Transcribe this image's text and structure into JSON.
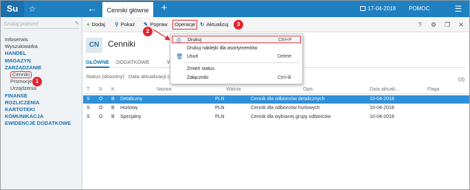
{
  "topbar": {
    "logo": "Su",
    "tab_title": "Cenniki główne",
    "date": "17-04-2018",
    "help": "POMOC"
  },
  "sidebar": {
    "search_placeholder": "Szukaj poleceń",
    "items": [
      {
        "label": "Infoserwis",
        "kind": "plain"
      },
      {
        "label": "Wyszukiwarka",
        "kind": "plain"
      },
      {
        "label": "HANDEL",
        "kind": "head"
      },
      {
        "label": "MAGAZYN",
        "kind": "head"
      },
      {
        "label": "ZARZĄDZANIE",
        "kind": "head"
      },
      {
        "label": "Cenniki",
        "kind": "sub"
      },
      {
        "label": "Promocje",
        "kind": "sub"
      },
      {
        "label": "Urządzenia",
        "kind": "sub"
      },
      {
        "label": "FINANSE",
        "kind": "head"
      },
      {
        "label": "ROZLICZENIA",
        "kind": "head"
      },
      {
        "label": "KARTOTEKI",
        "kind": "head"
      },
      {
        "label": "KOMUNIKACJA",
        "kind": "head"
      },
      {
        "label": "EWIDENCJE DODATKOWE",
        "kind": "head"
      }
    ]
  },
  "toolbar": {
    "add": "Dodaj",
    "show": "Pokaż",
    "edit": "Popraw",
    "operations": "Operacje",
    "refresh": "Aktualizuj"
  },
  "header": {
    "badge": "CN",
    "title": "Cenniki",
    "tabs": [
      "GŁÓWNE",
      "DODATKOWE",
      "W"
    ],
    "filter_status": "Status (dowolny)",
    "filter_date": "Data aktualizacji (d",
    "count": "(3)"
  },
  "table": {
    "columns": [
      "T",
      "S",
      "K",
      "Nazwa",
      "Waluta",
      "Opis",
      "Data aktuali...",
      "Flaga"
    ],
    "rows": [
      {
        "t": "S",
        "s": "O",
        "k": "B",
        "name": "Detaliczny",
        "currency": "PLN",
        "desc": "Cennik dla odbiorców detalicznych",
        "date": "10-04-2018",
        "flag": "",
        "selected": true
      },
      {
        "t": "S",
        "s": "O",
        "k": "B",
        "name": "Hurtowy",
        "currency": "PLN",
        "desc": "Cennik dla odbiorców hurtowych",
        "date": "10-04-2018",
        "flag": "",
        "selected": false
      },
      {
        "t": "S",
        "s": "O",
        "k": "B",
        "name": "Specjalny",
        "currency": "PLN",
        "desc": "Cennik dla wybranej grupy odbiorców",
        "date": "10-04-2018",
        "flag": "",
        "selected": false
      }
    ]
  },
  "dropdown": {
    "print": "Drukuj",
    "print_shortcut": "Ctrl+P",
    "print_labels": "Drukuj naklejki dla asortymentów",
    "delete": "Usuń",
    "delete_shortcut": "Delete",
    "change_status": "Zmień status",
    "attachments": "Załączniki",
    "attachments_shortcut": "Ctrl+B"
  },
  "badges": [
    "1",
    "2",
    "3"
  ],
  "colors": {
    "accent": "#1e7fc1",
    "selection": "#2f8fd8",
    "highlight_red": "#e0242f"
  }
}
